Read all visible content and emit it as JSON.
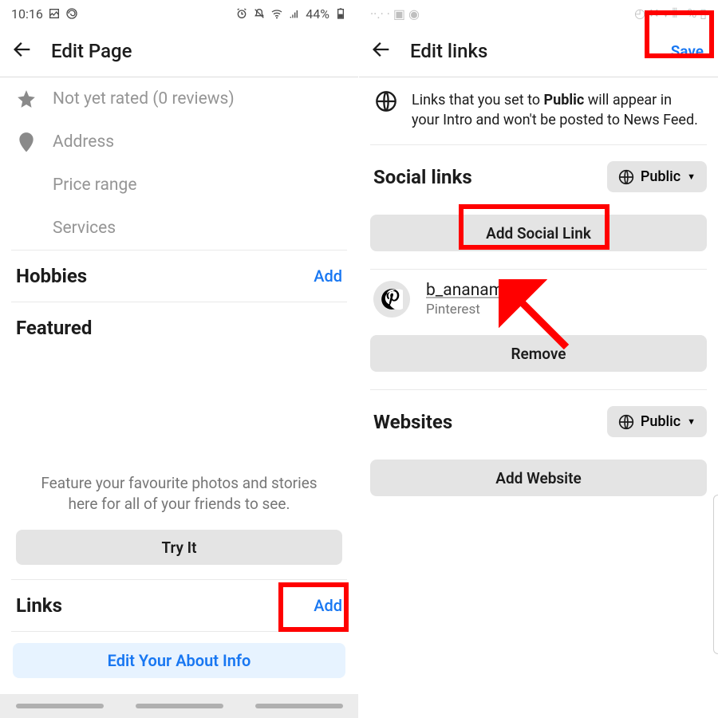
{
  "status_left": {
    "time": "10:16",
    "battery": "44%"
  },
  "left": {
    "header": "Edit Page",
    "rows": {
      "rating": "Not yet rated (0 reviews)",
      "address": "Address",
      "price": "Price range",
      "services": "Services"
    },
    "hobbies": {
      "title": "Hobbies",
      "action": "Add"
    },
    "featured": {
      "title": "Featured"
    },
    "feature_blurb": "Feature your favourite photos and stories here for all of your friends to see.",
    "try_it": "Try It",
    "links": {
      "title": "Links",
      "action": "Add"
    },
    "edit_about": "Edit Your About Info"
  },
  "right": {
    "header": "Edit links",
    "save": "Save",
    "info_pre": "Links that you set to ",
    "info_bold": "Public",
    "info_post": " will appear in your Intro and won't be posted to News Feed.",
    "social_title": "Social links",
    "privacy_label": "Public",
    "add_social": "Add Social Link",
    "link1": {
      "name": "b_ananaman",
      "sub": "Pinterest"
    },
    "remove": "Remove",
    "websites_title": "Websites",
    "add_website": "Add Website"
  }
}
